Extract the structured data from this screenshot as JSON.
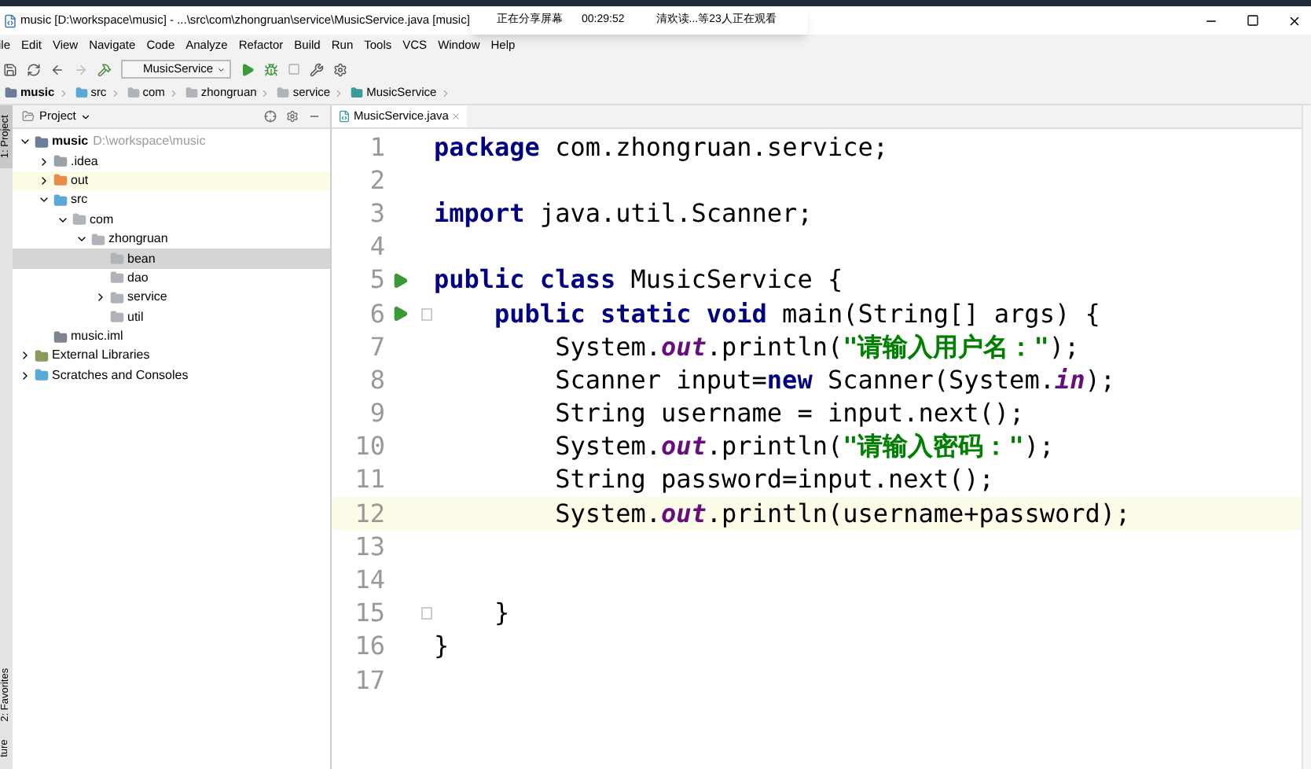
{
  "window": {
    "title": "music [D:\\workspace\\music] - ...\\src\\com\\zhongruan\\service\\MusicService.java [music]"
  },
  "share_overlay": {
    "status": "正在分享屏幕",
    "time": "00:29:52",
    "viewers": "清欢读...等23人正在观看"
  },
  "menu": [
    "ile",
    "Edit",
    "View",
    "Navigate",
    "Code",
    "Analyze",
    "Refactor",
    "Build",
    "Run",
    "Tools",
    "VCS",
    "Window",
    "Help"
  ],
  "toolbar": {
    "run_config": "MusicService"
  },
  "breadcrumb": [
    {
      "label": "music",
      "kind": "module"
    },
    {
      "label": "src",
      "kind": "source"
    },
    {
      "label": "com",
      "kind": "package"
    },
    {
      "label": "zhongruan",
      "kind": "package"
    },
    {
      "label": "service",
      "kind": "package"
    },
    {
      "label": "MusicService",
      "kind": "class"
    }
  ],
  "side_strip": [
    "1: Project",
    "2: Favorites",
    "ture"
  ],
  "project_panel": {
    "title": "Project",
    "tree": [
      {
        "label": "music",
        "path": "D:\\workspace\\music",
        "kind": "module",
        "expanded": true,
        "selected": false,
        "children": [
          {
            "label": ".idea",
            "kind": "folder",
            "expanded": false,
            "selected": false
          },
          {
            "label": "out",
            "kind": "output",
            "expanded": false,
            "selected": false,
            "highlighted": true
          },
          {
            "label": "src",
            "kind": "source",
            "expanded": true,
            "selected": false,
            "children": [
              {
                "label": "com",
                "kind": "package",
                "expanded": true,
                "selected": false,
                "children": [
                  {
                    "label": "zhongruan",
                    "kind": "package",
                    "expanded": true,
                    "selected": false,
                    "children": [
                      {
                        "label": "bean",
                        "kind": "package",
                        "selected": true
                      },
                      {
                        "label": "dao",
                        "kind": "package",
                        "selected": false
                      },
                      {
                        "label": "service",
                        "kind": "package",
                        "expanded": false,
                        "selected": false
                      },
                      {
                        "label": "util",
                        "kind": "package",
                        "selected": false
                      }
                    ]
                  }
                ]
              }
            ]
          },
          {
            "label": "music.iml",
            "kind": "file",
            "selected": false
          }
        ]
      },
      {
        "label": "External Libraries",
        "kind": "libraries",
        "expanded": false,
        "selected": false
      },
      {
        "label": "Scratches and Consoles",
        "kind": "scratches",
        "expanded": false,
        "selected": false
      }
    ]
  },
  "editor": {
    "tab": {
      "label": "MusicService.java",
      "selected": true
    },
    "lines": [
      {
        "number": "1",
        "current": false,
        "tokens": [
          {
            "kind": "keyword",
            "text": "package"
          },
          {
            "kind": "plain",
            "text": " com.zhongruan.service;"
          }
        ]
      },
      {
        "number": "2",
        "current": false
      },
      {
        "number": "3",
        "current": false,
        "tokens": [
          {
            "kind": "keyword",
            "text": "import"
          },
          {
            "kind": "plain",
            "text": " java.util.Scanner;"
          }
        ]
      },
      {
        "number": "4",
        "current": false
      },
      {
        "number": "5",
        "current": false,
        "run": true,
        "tokens": [
          {
            "kind": "keyword",
            "text": "public class"
          },
          {
            "kind": "plain",
            "text": " MusicService {"
          }
        ]
      },
      {
        "number": "6",
        "current": false,
        "run": true,
        "fold": true,
        "tokens": [
          {
            "kind": "keyword",
            "text": "    public static void"
          },
          {
            "kind": "plain",
            "text": " main(String[] args) {"
          }
        ]
      },
      {
        "number": "7",
        "current": false,
        "tokens": [
          {
            "kind": "plain",
            "text": "        System."
          },
          {
            "kind": "field",
            "text": "out"
          },
          {
            "kind": "plain",
            "text": ".println("
          },
          {
            "kind": "string",
            "text": "\"请输入用户名：\""
          },
          {
            "kind": "plain",
            "text": ");"
          }
        ]
      },
      {
        "number": "8",
        "current": false,
        "tokens": [
          {
            "kind": "plain",
            "text": "        Scanner input="
          },
          {
            "kind": "keyword",
            "text": "new"
          },
          {
            "kind": "plain",
            "text": " Scanner(System."
          },
          {
            "kind": "field",
            "text": "in"
          },
          {
            "kind": "plain",
            "text": ");"
          }
        ]
      },
      {
        "number": "9",
        "current": false,
        "tokens": [
          {
            "kind": "plain",
            "text": "        String username = input.next();"
          }
        ]
      },
      {
        "number": "10",
        "current": false,
        "tokens": [
          {
            "kind": "plain",
            "text": "        System."
          },
          {
            "kind": "field",
            "text": "out"
          },
          {
            "kind": "plain",
            "text": ".println("
          },
          {
            "kind": "string",
            "text": "\"请输入密码：\""
          },
          {
            "kind": "plain",
            "text": ");"
          }
        ]
      },
      {
        "number": "11",
        "current": false,
        "tokens": [
          {
            "kind": "plain",
            "text": "        String password=input.next();"
          }
        ]
      },
      {
        "number": "12",
        "current": true,
        "tokens": [
          {
            "kind": "plain",
            "text": "        System."
          },
          {
            "kind": "field",
            "text": "out"
          },
          {
            "kind": "plain",
            "text": ".println(username+password);"
          }
        ]
      },
      {
        "number": "13",
        "current": false
      },
      {
        "number": "14",
        "current": false
      },
      {
        "number": "15",
        "current": false,
        "fold": true,
        "tokens": [
          {
            "kind": "plain",
            "text": "    }"
          }
        ]
      },
      {
        "number": "16",
        "current": false,
        "tokens": [
          {
            "kind": "plain",
            "text": "}"
          }
        ]
      },
      {
        "number": "17",
        "current": false
      }
    ]
  }
}
